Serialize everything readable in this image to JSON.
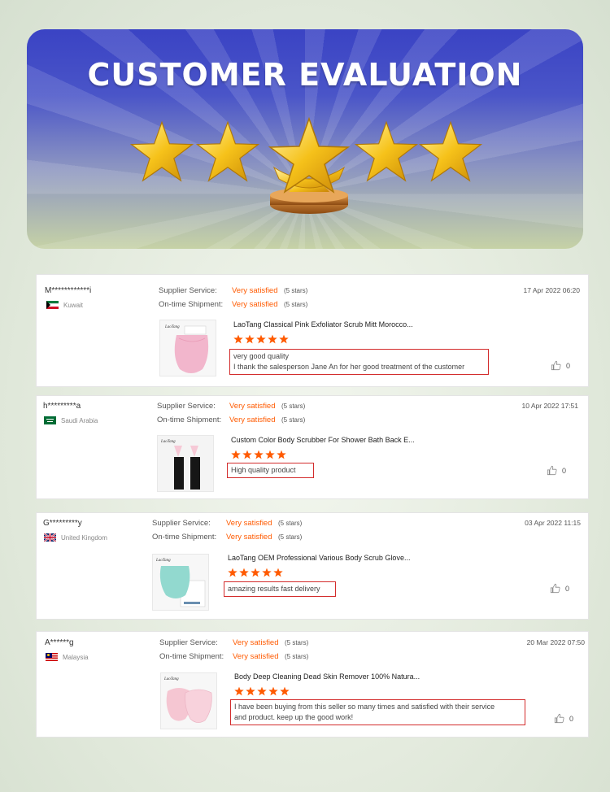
{
  "banner": {
    "title": "CUSTOMER EVALUATION"
  },
  "reviews": [
    {
      "user": "M************i",
      "country": "Kuwait",
      "supplier_label": "Supplier Service:",
      "supplier_value": "Very satisfied",
      "supplier_stars": "(5 stars)",
      "shipment_label": "On-time Shipment:",
      "shipment_value": "Very satisfied",
      "shipment_stars": "(5 stars)",
      "date": "17 Apr 2022 06:20",
      "product": "LaoTang Classical Pink Exfoliator Scrub Mitt Morocco...",
      "rating": 5,
      "review_lines": [
        "very good quality",
        "I thank the salesperson Jane An for her good treatment of the customer"
      ],
      "likes": "0"
    },
    {
      "user": "h*********a",
      "country": "Saudi Arabia",
      "supplier_label": "Supplier Service:",
      "supplier_value": "Very satisfied",
      "supplier_stars": "(5 stars)",
      "shipment_label": "On-time Shipment:",
      "shipment_value": "Very satisfied",
      "shipment_stars": "(5 stars)",
      "date": "10 Apr 2022 17:51",
      "product": "Custom Color Body Scrubber For Shower Bath Back E...",
      "rating": 5,
      "review_lines": [
        "High quality product"
      ],
      "likes": "0"
    },
    {
      "user": "G*********y",
      "country": "United Kingdom",
      "supplier_label": "Supplier Service:",
      "supplier_value": "Very satisfied",
      "supplier_stars": "(5 stars)",
      "shipment_label": "On-time Shipment:",
      "shipment_value": "Very satisfied",
      "shipment_stars": "(5 stars)",
      "date": "03 Apr 2022 11:15",
      "product": "LaoTang OEM Professional Various Body Scrub Glove...",
      "rating": 5,
      "review_lines": [
        "amazing results fast delivery"
      ],
      "likes": "0"
    },
    {
      "user": "A******g",
      "country": "Malaysia",
      "supplier_label": "Supplier Service:",
      "supplier_value": "Very satisfied",
      "supplier_stars": "(5 stars)",
      "shipment_label": "On-time Shipment:",
      "shipment_value": "Very satisfied",
      "shipment_stars": "(5 stars)",
      "date": "20 Mar 2022 07:50",
      "product": "Body Deep Cleaning Dead Skin Remover 100% Natura...",
      "rating": 5,
      "review_lines": [
        "I have been buying from this seller so many times and satisfied with their service",
        "and product. keep up the good work!"
      ],
      "likes": "0"
    }
  ],
  "colors": {
    "accent": "#ff5a00",
    "star": "#ff5a00",
    "highlight_border": "#d32c2c",
    "banner_top": "#3a43c4"
  },
  "icons": {
    "like": "thumbs-up-icon",
    "star": "star-icon"
  }
}
